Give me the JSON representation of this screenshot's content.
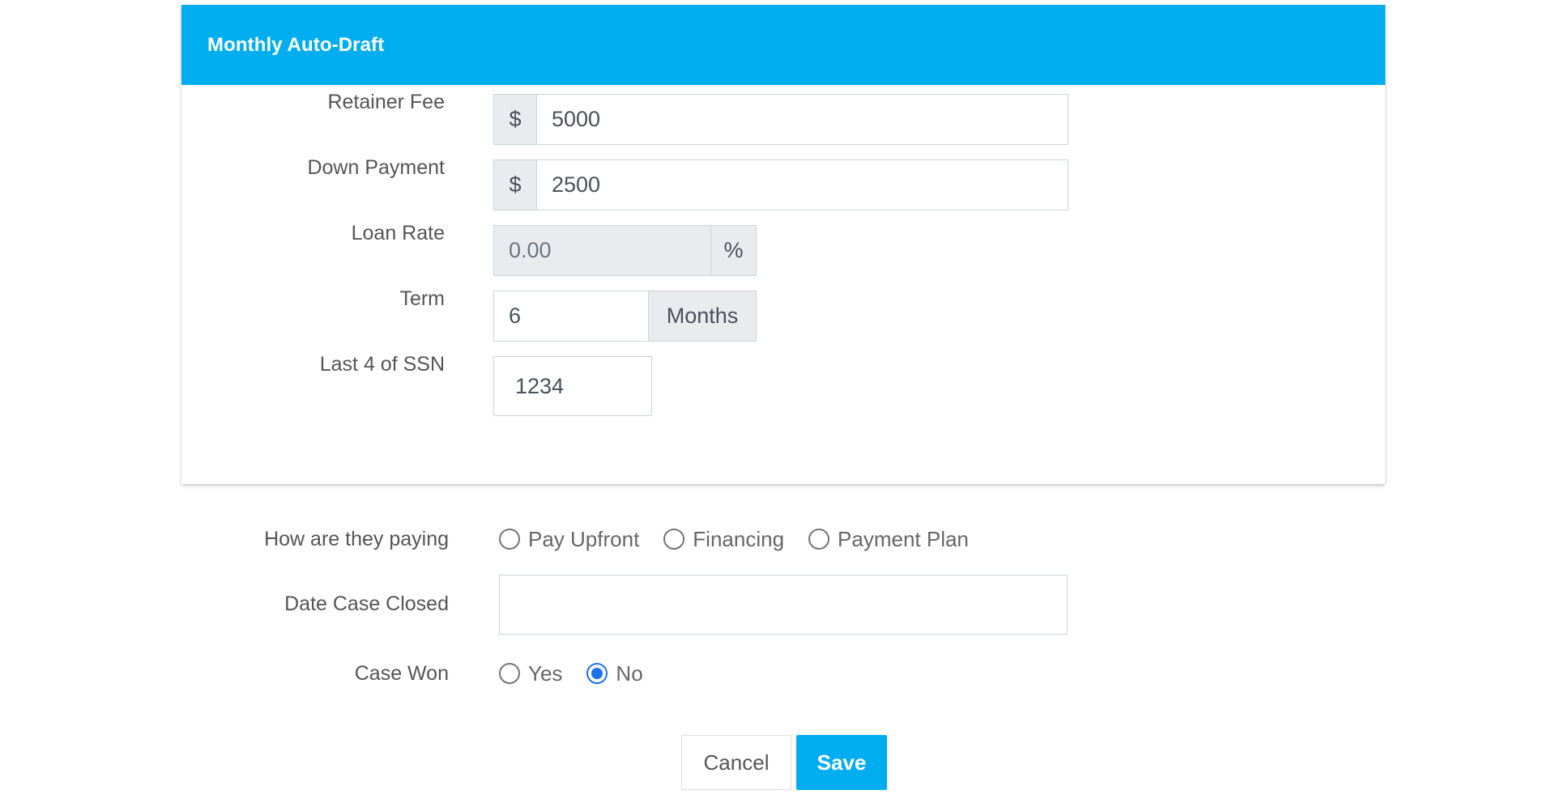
{
  "card": {
    "title": "Monthly Auto-Draft"
  },
  "form": {
    "retainer_fee": {
      "label": "Retainer Fee",
      "prefix": "$",
      "value": "5000"
    },
    "down_payment": {
      "label": "Down Payment",
      "prefix": "$",
      "value": "2500"
    },
    "loan_rate": {
      "label": "Loan Rate",
      "value": "0.00",
      "suffix": "%"
    },
    "term": {
      "label": "Term",
      "value": "6",
      "suffix": "Months"
    },
    "ssn_last4": {
      "label": "Last 4 of SSN",
      "value": "1234"
    }
  },
  "payment": {
    "label": "How are they paying",
    "options": [
      {
        "label": "Pay Upfront",
        "checked": false
      },
      {
        "label": "Financing",
        "checked": false
      },
      {
        "label": "Payment Plan",
        "checked": false
      }
    ]
  },
  "date_closed": {
    "label": "Date Case Closed",
    "value": ""
  },
  "case_won": {
    "label": "Case Won",
    "options": [
      {
        "label": "Yes",
        "checked": false
      },
      {
        "label": "No",
        "checked": true
      }
    ]
  },
  "buttons": {
    "cancel": "Cancel",
    "save": "Save"
  },
  "colors": {
    "accent": "#00aeef",
    "radio_checked": "#1a73e8"
  }
}
